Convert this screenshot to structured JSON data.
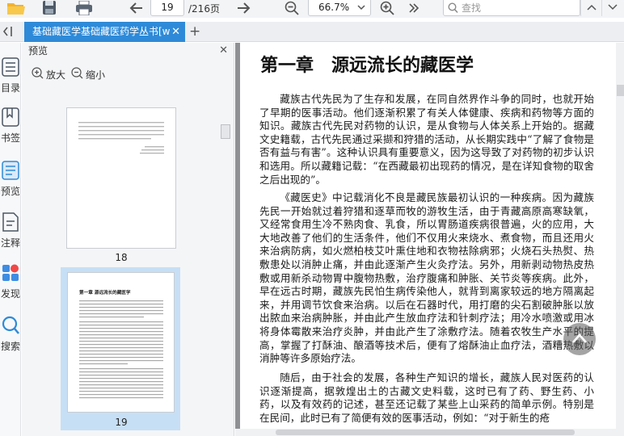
{
  "toolbar": {
    "page_current": "19",
    "page_total": "/216页",
    "zoom_value": "66.7%",
    "search_placeholder": "查找"
  },
  "tabs": [
    {
      "label": "基础藏医学基础藏医药学丛书[w"
    }
  ],
  "leftnav": {
    "items": [
      {
        "label": "目录",
        "icon": "list-icon"
      },
      {
        "label": "书签",
        "icon": "bookmark-icon"
      },
      {
        "label": "预览",
        "icon": "preview-icon"
      },
      {
        "label": "注释",
        "icon": "note-icon"
      },
      {
        "label": "发现",
        "icon": "discover-icon"
      },
      {
        "label": "搜索",
        "icon": "search-icon"
      }
    ]
  },
  "preview": {
    "title": "预览",
    "zoom_in": "放大",
    "zoom_out": "缩小",
    "thumbs": [
      {
        "num": "18"
      },
      {
        "num": "19",
        "title": "第一章 源远流长的藏医学"
      }
    ]
  },
  "document": {
    "chapter_title": "第一章　源远流长的藏医学",
    "paragraphs": [
      "藏族古代先民为了生存和发展，在同自然界作斗争的同时，也就开始了早期的医事活动。他们逐渐积累了有关人体健康、疾病和药物等方面的知识。藏族古代先民对药物的认识，是从食物与人体关系上开始的。据藏文史籍载，古代先民通过采撷和狩猎的活动，从长期实践中“了解了食物是否有益与有害”。这种认识具有重要意义，因为这导致了对药物的初步认识和选用。所以藏籍记载：“在西藏最初出现药的情况，是在详知食物的取舍之后出现的”。",
      "《藏医史》中记载消化不良是藏民族最初认识的一种疾病。因为藏族先民一开始就过着狩猎和逐草而牧的游牧生活，由于青藏高原高寒缺氧，又经常食用生冷不熟肉食、乳食，所以胃肠道疾病很普遍，火的应用，大大地改善了他们的生活条件，他们不仅用火来烧水、煮食物，而且还用火来治病防病，如火燃柏枝艾叶熏住地和衣物祛除病邪；火烧石头热熨、热敷患处以消肿止痛，并由此逐渐产生火灸疗法。另外，用新剥动物热皮热敷或用新杀动物胃中腹物热敷，治疗腹痛和肿胀、关节炎等疾病。此外，早在远古时期，藏族先民怕生病传染他人，就背到离家较远的地方隔离起来，并用调节饮食来治病。以后在石器时代，用打磨的尖石割破肿胀以放出脓血来治病肿胀，并由此产生放血疗法和针刺疗法；用冷水喷激或用冰将身体霉散来治疗炎肿，并由此产生了涂敷疗法。随着农牧生产水平的提高，掌握了打酥油、酿酒等技术后，便有了熔酥油止血疗法，酒糟热敷以消肿等许多原始疗法。",
      "随后，由于社会的发展，各种生产知识的增长，藏族人民对医药的认识逐渐提高，据敦煌出土的古藏文史料载，这时已有了药、野生药、小药，以及有效药的记述，甚至还记载了某些上山采药的简单示例。特别是在民间，此时已有了简便有效的医事活动，例如：“对于新生的疮"
    ]
  },
  "colors": {
    "accent": "#2e8ad8",
    "toolbar_bg": "#f3f4f6",
    "doc_bg": "#8e9094",
    "thumb_selected": "#c7dff5"
  }
}
